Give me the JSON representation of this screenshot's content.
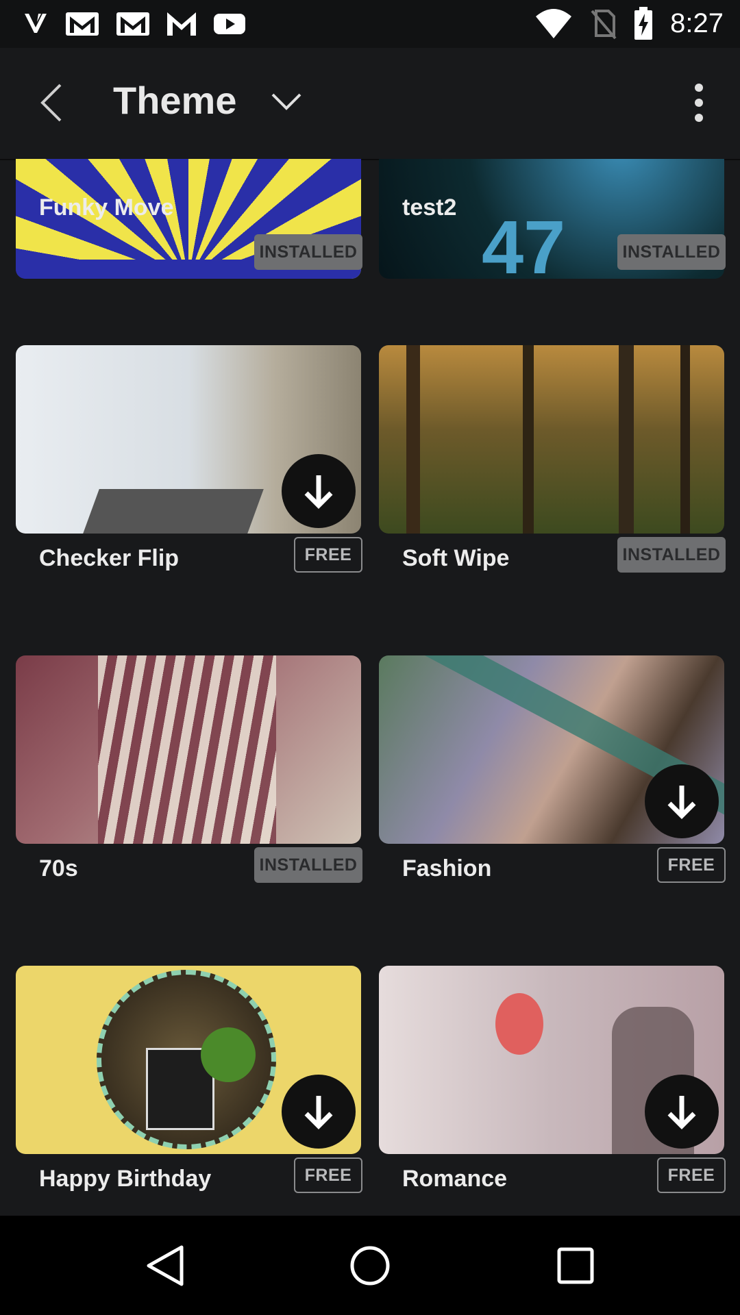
{
  "status_bar": {
    "time": "8:27",
    "left_icons": [
      "v-app-icon",
      "gmail-icon",
      "gmail-icon",
      "gmail-icon",
      "youtube-icon"
    ],
    "right_icons": [
      "wifi-icon",
      "no-sim-icon",
      "battery-charging-icon"
    ]
  },
  "app_bar": {
    "title": "Theme"
  },
  "themes": [
    {
      "name": "Funky Move",
      "status": "INSTALLED",
      "downloadable": false,
      "colors": [
        "#f0e44a",
        "#2a2fa8"
      ]
    },
    {
      "name": "test2",
      "status": "INSTALLED",
      "downloadable": false,
      "colors": [
        "#0d2a30",
        "#3a8cb5"
      ]
    },
    {
      "name": "Checker Flip",
      "status": "FREE",
      "downloadable": true,
      "colors": [
        "#e9edf1",
        "#8c8472"
      ]
    },
    {
      "name": "Soft Wipe",
      "status": "INSTALLED",
      "downloadable": false,
      "colors": [
        "#b98a3e",
        "#3d4a1f"
      ]
    },
    {
      "name": "70s",
      "status": "INSTALLED",
      "downloadable": false,
      "colors": [
        "#7a3c48",
        "#cfc2b5"
      ]
    },
    {
      "name": "Fashion",
      "status": "FREE",
      "downloadable": true,
      "colors": [
        "#8f8aa8",
        "#5a7a5e"
      ]
    },
    {
      "name": "Happy Birthday",
      "status": "FREE",
      "downloadable": true,
      "colors": [
        "#ecd66a",
        "#4b6a3a"
      ]
    },
    {
      "name": "Romance",
      "status": "FREE",
      "downloadable": true,
      "colors": [
        "#e6dcdc",
        "#b8a0a6"
      ]
    }
  ],
  "nav_bar": {
    "buttons": [
      "back-nav-icon",
      "home-nav-icon",
      "recents-nav-icon"
    ]
  }
}
